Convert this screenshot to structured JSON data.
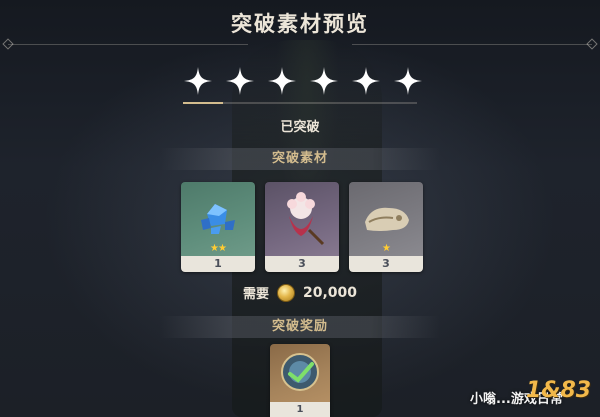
{
  "header": {
    "title": "突破素材预览"
  },
  "ascension": {
    "stars": 6,
    "filled_stars": 6,
    "progress": 0.17,
    "status": "已突破"
  },
  "materials": {
    "section_title": "突破素材",
    "items": [
      {
        "name": "gemstone",
        "count": "1",
        "rarity_stars": "★★",
        "icon": "blue-gem-icon"
      },
      {
        "name": "flower",
        "count": "3",
        "rarity_stars": "",
        "icon": "flower-icon"
      },
      {
        "name": "bone",
        "count": "3",
        "rarity_stars": "★",
        "icon": "bone-icon"
      }
    ],
    "cost_label": "需要",
    "cost_amount": "20,000",
    "cost_icon": "mora-coin-icon"
  },
  "rewards": {
    "section_title": "突破奖励",
    "items": [
      {
        "name": "reward",
        "count": "1",
        "icon": "acquaint-fate-icon"
      }
    ]
  },
  "watermark": {
    "text": "小嗡...游戏日常",
    "logo": "1&83"
  },
  "colors": {
    "accent": "#d3bc8e",
    "text": "#ece5d8",
    "background": "#1b1f27",
    "rarity_star": "#ffcc32"
  }
}
